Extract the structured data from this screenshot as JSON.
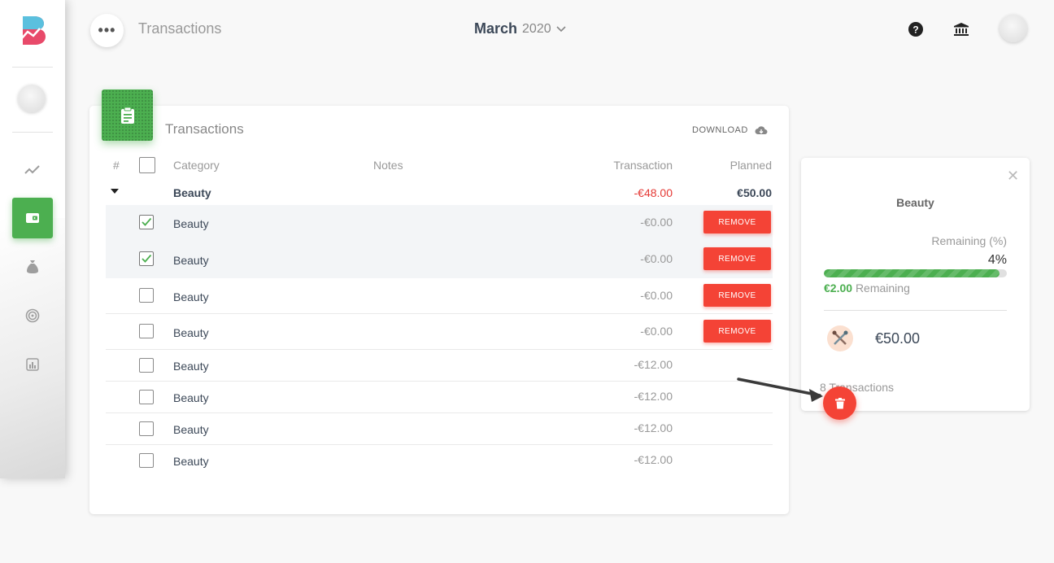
{
  "header": {
    "title": "Transactions",
    "month": "March",
    "year": "2020",
    "menu_label": "•••",
    "icons": [
      "help-icon",
      "bank-icon"
    ]
  },
  "sidebar": {
    "items": [
      {
        "name": "trend-icon",
        "active": false
      },
      {
        "name": "wallet-icon",
        "active": true
      },
      {
        "name": "money-bag-icon",
        "active": false
      },
      {
        "name": "target-icon",
        "active": false
      },
      {
        "name": "chart-icon",
        "active": false
      }
    ]
  },
  "card": {
    "title": "Transactions",
    "download_label": "DOWNLOAD",
    "columns": {
      "index": "#",
      "category": "Category",
      "notes": "Notes",
      "transaction": "Transaction",
      "planned": "Planned"
    },
    "group": {
      "category": "Beauty",
      "transaction": "-€48.00",
      "planned": "€50.00"
    },
    "rows": [
      {
        "category": "Beauty",
        "amount": "-€0.00",
        "checked": true,
        "remove": "REMOVE"
      },
      {
        "category": "Beauty",
        "amount": "-€0.00",
        "checked": true,
        "remove": "REMOVE"
      },
      {
        "category": "Beauty",
        "amount": "-€0.00",
        "checked": false,
        "remove": "REMOVE"
      },
      {
        "category": "Beauty",
        "amount": "-€0.00",
        "checked": false,
        "remove": "REMOVE"
      },
      {
        "category": "Beauty",
        "amount": "-€12.00",
        "checked": false
      },
      {
        "category": "Beauty",
        "amount": "-€12.00",
        "checked": false
      },
      {
        "category": "Beauty",
        "amount": "-€12.00",
        "checked": false
      },
      {
        "category": "Beauty",
        "amount": "-€12.00",
        "checked": false
      }
    ]
  },
  "panel": {
    "title": "Beauty",
    "remaining_label": "Remaining (%)",
    "remaining_percent": "4%",
    "remaining_fraction": 0.96,
    "remaining_value": "€2.00",
    "remaining_text": "Remaining",
    "planned": "€50.00",
    "transactions_count": "8 Transactions"
  },
  "colors": {
    "accent": "#4caf50",
    "danger": "#f44336",
    "negative": "#e53935"
  }
}
